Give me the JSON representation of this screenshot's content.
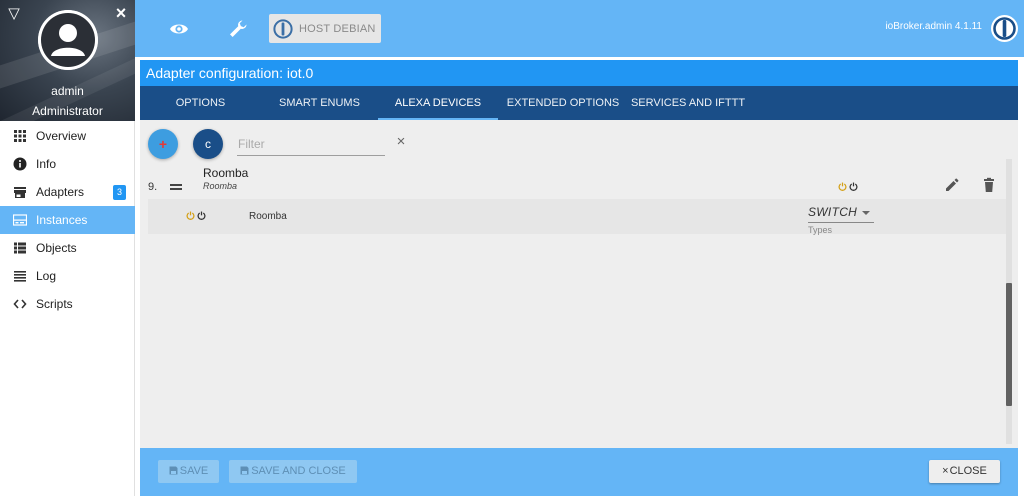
{
  "sidebar": {
    "user": {
      "name": "admin",
      "role": "Administrator"
    },
    "items": [
      {
        "label": "Overview",
        "icon": "grid-icon"
      },
      {
        "label": "Info",
        "icon": "info-icon"
      },
      {
        "label": "Adapters",
        "icon": "store-icon",
        "badge": "3"
      },
      {
        "label": "Instances",
        "icon": "instances-icon",
        "active": true
      },
      {
        "label": "Objects",
        "icon": "list-icon"
      },
      {
        "label": "Log",
        "icon": "log-icon"
      },
      {
        "label": "Scripts",
        "icon": "code-icon"
      }
    ]
  },
  "topbar": {
    "host_label": "HOST DEBIAN",
    "version": "ioBroker.admin 4.1.11"
  },
  "dialog": {
    "title": "Adapter configuration: iot.0",
    "tabs": [
      {
        "label": "OPTIONS"
      },
      {
        "label": "SMART ENUMS"
      },
      {
        "label": "ALEXA DEVICES",
        "active": true
      },
      {
        "label": "EXTENDED OPTIONS"
      },
      {
        "label": "SERVICES AND IFTTT"
      }
    ],
    "toolbar": {
      "add_glyph": "+",
      "refresh_glyph": "c",
      "filter_placeholder": "Filter",
      "clear_glyph": "×"
    },
    "devices": [
      {
        "index": "9.",
        "name": "Roomba",
        "subtitle": "Roomba",
        "states": [
          {
            "name": "Roomba",
            "type": "SWITCH",
            "type_label": "Types"
          }
        ]
      }
    ],
    "footer": {
      "save_label": "SAVE",
      "save_close_label": "SAVE AND CLOSE",
      "close_label": "CLOSE",
      "close_glyph": "×"
    }
  },
  "colors": {
    "topbar": "#64b5f6",
    "title_bar": "#2196f3",
    "tabs_bar": "#1a4e88",
    "active_nav": "#64b5f6",
    "power_on": "#d4a017",
    "power_off": "#333333"
  }
}
